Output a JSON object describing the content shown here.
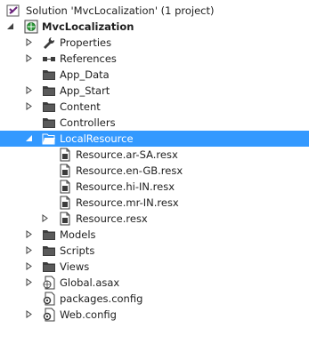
{
  "explorer": {
    "solution": {
      "label": "Solution 'MvcLocalization' (1 project)"
    },
    "project": {
      "label": "MvcLocalization"
    },
    "items": {
      "properties": "Properties",
      "references": "References",
      "app_data": "App_Data",
      "app_start": "App_Start",
      "content": "Content",
      "controllers": "Controllers",
      "localresource": "LocalResource",
      "res_ar": "Resource.ar-SA.resx",
      "res_en": "Resource.en-GB.resx",
      "res_hi": "Resource.hi-IN.resx",
      "res_mr": "Resource.mr-IN.resx",
      "res_default": "Resource.resx",
      "models": "Models",
      "scripts": "Scripts",
      "views": "Views",
      "global": "Global.asax",
      "packages": "packages.config",
      "webconfig": "Web.config"
    },
    "colors": {
      "selection": "#3399ff",
      "folder": "#3c3c3c",
      "text": "#1e1e1e"
    }
  }
}
